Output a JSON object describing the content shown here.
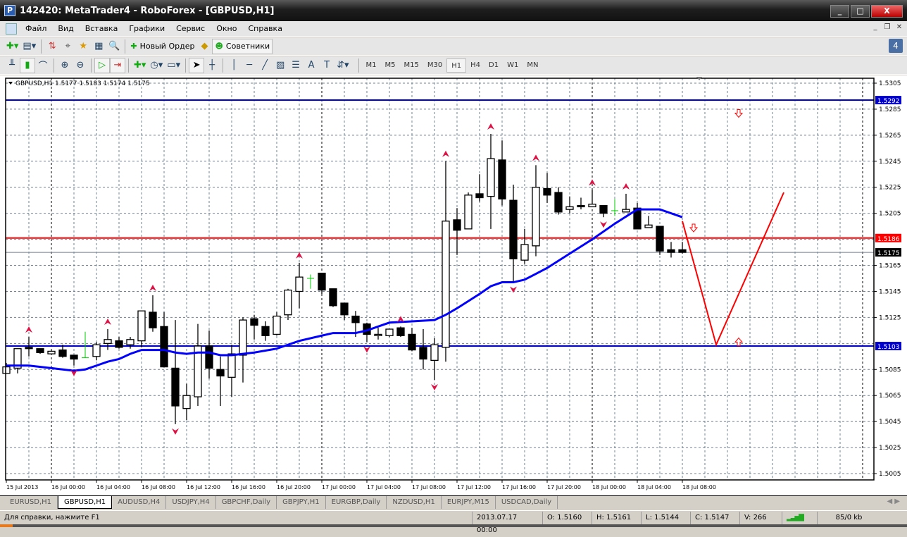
{
  "window": {
    "title": "142420: MetaTrader4 - RoboForex - [GBPUSD,H1]",
    "minimize": "_",
    "maximize": "□",
    "close": "X"
  },
  "menu": [
    "Файл",
    "Вид",
    "Вставка",
    "Графики",
    "Сервис",
    "Окно",
    "Справка"
  ],
  "mdi": {
    "minimize": "_",
    "restore": "❐",
    "close": "✕"
  },
  "toolbar": {
    "new_order": "Новый Ордер",
    "experts": "Советники",
    "notifications": "4"
  },
  "timeframes": [
    "M1",
    "M5",
    "M15",
    "M30",
    "H1",
    "H4",
    "D1",
    "W1",
    "MN"
  ],
  "active_timeframe": "H1",
  "chart_header": "GBPUSD,H1  1.5177 1.5183 1.5174 1.5175",
  "colors": {
    "ma": "#0000ff",
    "support": "#0000cc",
    "resistance": "#ff0000",
    "bid": "#000000",
    "fractal": "#dd1144",
    "doji": "#00cc00"
  },
  "chart_data": {
    "type": "candlestick",
    "symbol": "GBPUSD",
    "timeframe": "H1",
    "ylim": [
      1.5,
      1.5305
    ],
    "price_ticks": [
      "1.5305",
      "1.5285",
      "1.5265",
      "1.5245",
      "1.5225",
      "1.5205",
      "1.5165",
      "1.5145",
      "1.5125",
      "1.5085",
      "1.5065",
      "1.5045",
      "1.5025",
      "1.5005"
    ],
    "time_labels": [
      "15 Jul 2013",
      "16 Jul 00:00",
      "16 Jul 04:00",
      "16 Jul 08:00",
      "16 Jul 12:00",
      "16 Jul 16:00",
      "16 Jul 20:00",
      "17 Jul 00:00",
      "17 Jul 04:00",
      "17 Jul 08:00",
      "17 Jul 12:00",
      "17 Jul 16:00",
      "17 Jul 20:00",
      "18 Jul 00:00",
      "18 Jul 04:00",
      "18 Jul 08:00"
    ],
    "ohlc": [
      [
        1.5082,
        1.509,
        1.5082,
        1.5087
      ],
      [
        1.5086,
        1.5101,
        1.5082,
        1.5101
      ],
      [
        1.5102,
        1.511,
        1.5095,
        1.5101
      ],
      [
        1.5101,
        1.5101,
        1.5097,
        1.5098
      ],
      [
        1.5097,
        1.51,
        1.5097,
        1.5099
      ],
      [
        1.51,
        1.5104,
        1.5094,
        1.5095
      ],
      [
        1.5096,
        1.5096,
        1.5088,
        1.5093
      ],
      [
        1.5094,
        1.5114,
        1.5094,
        1.5094
      ],
      [
        1.5095,
        1.5106,
        1.5092,
        1.5104
      ],
      [
        1.5105,
        1.5116,
        1.51,
        1.5108
      ],
      [
        1.5107,
        1.511,
        1.5101,
        1.5102
      ],
      [
        1.5104,
        1.511,
        1.5101,
        1.5108
      ],
      [
        1.5107,
        1.513,
        1.5102,
        1.513
      ],
      [
        1.5129,
        1.5142,
        1.5114,
        1.5117
      ],
      [
        1.5118,
        1.5129,
        1.5087,
        1.5087
      ],
      [
        1.5086,
        1.5123,
        1.5043,
        1.5057
      ],
      [
        1.5055,
        1.5074,
        1.5046,
        1.5065
      ],
      [
        1.5064,
        1.512,
        1.5057,
        1.5103
      ],
      [
        1.5103,
        1.5115,
        1.5078,
        1.5086
      ],
      [
        1.5085,
        1.5095,
        1.5057,
        1.508
      ],
      [
        1.5079,
        1.5104,
        1.5064,
        1.5097
      ],
      [
        1.5096,
        1.5125,
        1.5075,
        1.5123
      ],
      [
        1.5124,
        1.5127,
        1.5108,
        1.5119
      ],
      [
        1.5118,
        1.5122,
        1.5107,
        1.5111
      ],
      [
        1.5112,
        1.5129,
        1.5111,
        1.5126
      ],
      [
        1.5127,
        1.5147,
        1.5123,
        1.5146
      ],
      [
        1.5145,
        1.5167,
        1.5132,
        1.5156
      ],
      [
        1.5155,
        1.5158,
        1.5147,
        1.5155
      ],
      [
        1.5159,
        1.5159,
        1.5143,
        1.5146
      ],
      [
        1.5147,
        1.5147,
        1.5133,
        1.5134
      ],
      [
        1.5136,
        1.5136,
        1.5123,
        1.5127
      ],
      [
        1.5126,
        1.513,
        1.511,
        1.5121
      ],
      [
        1.512,
        1.5121,
        1.5106,
        1.5112
      ],
      [
        1.5111,
        1.5117,
        1.5108,
        1.5112
      ],
      [
        1.5111,
        1.5116,
        1.511,
        1.5116
      ],
      [
        1.5117,
        1.5118,
        1.511,
        1.5111
      ],
      [
        1.5112,
        1.5117,
        1.5099,
        1.51
      ],
      [
        1.5102,
        1.5116,
        1.5085,
        1.5093
      ],
      [
        1.5092,
        1.5109,
        1.5077,
        1.5104
      ],
      [
        1.5102,
        1.5245,
        1.5091,
        1.5199
      ],
      [
        1.52,
        1.5209,
        1.5173,
        1.5192
      ],
      [
        1.5193,
        1.5221,
        1.5193,
        1.5219
      ],
      [
        1.522,
        1.5235,
        1.5214,
        1.5217
      ],
      [
        1.5218,
        1.5266,
        1.5193,
        1.5247
      ],
      [
        1.5246,
        1.5261,
        1.5211,
        1.5216
      ],
      [
        1.5215,
        1.5227,
        1.5152,
        1.517
      ],
      [
        1.5169,
        1.5193,
        1.5166,
        1.5181
      ],
      [
        1.518,
        1.5242,
        1.5172,
        1.5225
      ],
      [
        1.5224,
        1.5236,
        1.5213,
        1.5219
      ],
      [
        1.5221,
        1.5225,
        1.5204,
        1.5206
      ],
      [
        1.5208,
        1.5218,
        1.5205,
        1.521
      ],
      [
        1.5211,
        1.5217,
        1.5208,
        1.521
      ],
      [
        1.521,
        1.5223,
        1.521,
        1.5212
      ],
      [
        1.5211,
        1.5211,
        1.5202,
        1.5205
      ],
      [
        1.5207,
        1.5216,
        1.5203,
        1.5207
      ],
      [
        1.5206,
        1.522,
        1.5206,
        1.5208
      ],
      [
        1.5209,
        1.5213,
        1.5193,
        1.5193
      ],
      [
        1.5194,
        1.5203,
        1.5194,
        1.5196
      ],
      [
        1.5195,
        1.5195,
        1.5173,
        1.5176
      ],
      [
        1.5177,
        1.5183,
        1.5171,
        1.5175
      ],
      [
        1.5177,
        1.5183,
        1.5174,
        1.5175
      ]
    ],
    "moving_average": [
      [
        0,
        1.5088
      ],
      [
        2,
        1.5088
      ],
      [
        4,
        1.5086
      ],
      [
        6,
        1.5084
      ],
      [
        7,
        1.5085
      ],
      [
        8,
        1.5088
      ],
      [
        9,
        1.5091
      ],
      [
        10,
        1.5093
      ],
      [
        11,
        1.5097
      ],
      [
        12,
        1.51
      ],
      [
        13,
        1.51
      ],
      [
        14,
        1.51
      ],
      [
        15,
        1.5098
      ],
      [
        16,
        1.5097
      ],
      [
        17,
        1.5098
      ],
      [
        18,
        1.5098
      ],
      [
        19,
        1.5096
      ],
      [
        20,
        1.5096
      ],
      [
        21,
        1.5097
      ],
      [
        22,
        1.5098
      ],
      [
        24,
        1.5101
      ],
      [
        26,
        1.5107
      ],
      [
        28,
        1.5111
      ],
      [
        29,
        1.5113
      ],
      [
        31,
        1.5113
      ],
      [
        32,
        1.5115
      ],
      [
        33,
        1.5118
      ],
      [
        34,
        1.5121
      ],
      [
        36,
        1.5122
      ],
      [
        38,
        1.5123
      ],
      [
        39,
        1.5127
      ],
      [
        40,
        1.5132
      ],
      [
        42,
        1.5143
      ],
      [
        43,
        1.5149
      ],
      [
        44,
        1.5152
      ],
      [
        45,
        1.5152
      ],
      [
        46,
        1.5154
      ],
      [
        48,
        1.5163
      ],
      [
        50,
        1.5174
      ],
      [
        52,
        1.5185
      ],
      [
        54,
        1.5197
      ],
      [
        56,
        1.5208
      ],
      [
        58,
        1.5208
      ],
      [
        60,
        1.5202
      ]
    ],
    "fractals_up": [
      2,
      9,
      13,
      26,
      35,
      39,
      43,
      47,
      52,
      55
    ],
    "fractals_down": [
      6,
      15,
      32,
      38,
      45,
      53
    ],
    "hlines": [
      {
        "price": 1.5292,
        "label": "1.5292",
        "type": "support"
      },
      {
        "price": 1.5186,
        "label": "1.5186",
        "type": "resistance"
      },
      {
        "price": 1.5103,
        "label": "1.5103",
        "type": "support"
      }
    ],
    "bid": {
      "price": 1.5175,
      "label": "1.5175"
    },
    "forecast_path": [
      [
        60,
        1.5199
      ],
      [
        63,
        1.5104
      ],
      [
        69,
        1.5221
      ]
    ],
    "arrows": [
      {
        "index": 65,
        "price": 1.5282,
        "dir": "down"
      },
      {
        "index": 61,
        "price": 1.5194,
        "dir": "down"
      },
      {
        "index": 65,
        "price": 1.5106,
        "dir": "up"
      }
    ]
  },
  "symbol_tabs": [
    "EURUSD,H1",
    "GBPUSD,H1",
    "AUDUSD,H4",
    "USDJPY,H4",
    "GBPCHF,Daily",
    "GBPJPY,H1",
    "EURGBP,Daily",
    "NZDUSD,H1",
    "EURJPY,M15",
    "USDCAD,Daily"
  ],
  "active_tab": "GBPUSD,H1",
  "status": {
    "help": "Для справки, нажмите F1",
    "datetime": "2013.07.17 00:00",
    "open": "O: 1.5160",
    "high": "H: 1.5161",
    "low": "L: 1.5144",
    "close": "C: 1.5147",
    "volume": "V: 266",
    "traffic": "85/0 kb"
  }
}
